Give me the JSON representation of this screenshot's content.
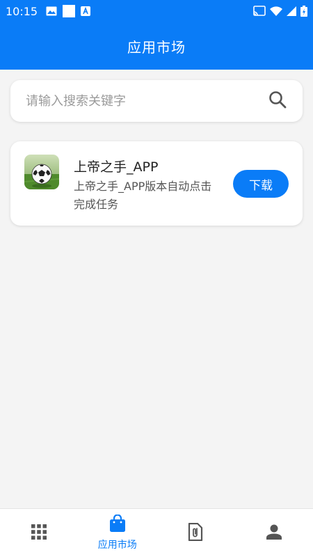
{
  "status_bar": {
    "time": "10:15",
    "left_icons": [
      "image-icon",
      "square-icon",
      "a-badge-icon"
    ],
    "right_icons": [
      "cast-icon",
      "wifi-icon",
      "signal-icon",
      "battery-icon"
    ]
  },
  "header": {
    "title": "应用市场"
  },
  "search": {
    "placeholder": "请输入搜索关键字",
    "value": ""
  },
  "apps": [
    {
      "name": "上帝之手_APP",
      "description": "上帝之手_APP版本自动点击完成任务",
      "action_label": "下载",
      "icon": "soccer-ball-icon"
    }
  ],
  "bottom_nav": {
    "items": [
      {
        "icon": "grid-icon",
        "label": "",
        "active": false
      },
      {
        "icon": "shopping-bag-icon",
        "label": "应用市场",
        "active": true
      },
      {
        "icon": "document-attachment-icon",
        "label": "",
        "active": false
      },
      {
        "icon": "person-icon",
        "label": "",
        "active": false
      }
    ]
  },
  "colors": {
    "primary": "#0a7cf7",
    "background": "#f4f4f4",
    "card": "#ffffff",
    "nav_inactive_icon": "#555555"
  }
}
